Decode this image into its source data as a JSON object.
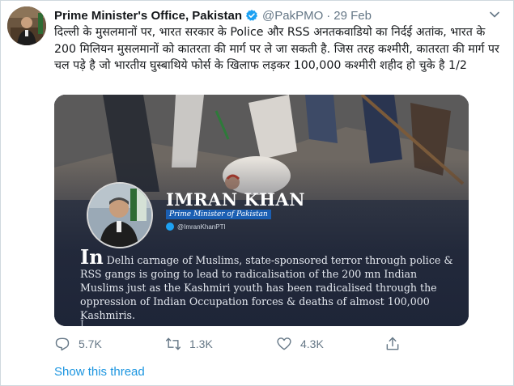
{
  "tweet": {
    "author_name": "Prime Minister's Office, Pakistan",
    "handle": "@PakPMO",
    "separator": "·",
    "date": "29 Feb",
    "text": "दिल्ली के मुसलमानों पर, भारत सरकार के Police और RSS अनतकवाडियो का निर्दई अतांक,  भारत के 200 मिलियन मुसलमानों को कातरता की मार्ग पर ले जा सकती है. जिस तरह कश्मीरी, कातरता की मार्ग पर चल पड़े है जो भारतीय घुस्बाथिये फोर्स के खिलाफ लड़कर 100,000 कश्मीरी शहीद हो चुके है 1/2"
  },
  "media_card": {
    "name": "IMRAN KHAN",
    "title": "Prime Minister of Pakistan",
    "handle": "@ImranKhanPTI",
    "quote_dropcap": "In",
    "quote_text": " Delhi carnage of Muslims, state-sponsored terror through police & RSS gangs is going to lead to radicalisation of the 200 mn Indian Muslims just as the Kashmiri youth has been radicalised through the oppression of Indian Occupation forces & deaths of almost 100,000 Kashmiris.",
    "quote_cutoff": "I                                  "
  },
  "actions": {
    "reply_count": "5.7K",
    "retweet_count": "1.3K",
    "like_count": "4.3K"
  },
  "show_thread": "Show this thread",
  "icons": {
    "verified": "verified-badge-icon",
    "more": "chevron-down-icon",
    "reply": "reply-icon",
    "retweet": "retweet-icon",
    "like": "heart-icon",
    "share": "share-icon"
  },
  "colors": {
    "link": "#1b95e0",
    "muted": "#657786",
    "verified": "#1da1f2",
    "card_bg": "#1e2538",
    "title_badge": "#1b5fb3"
  }
}
